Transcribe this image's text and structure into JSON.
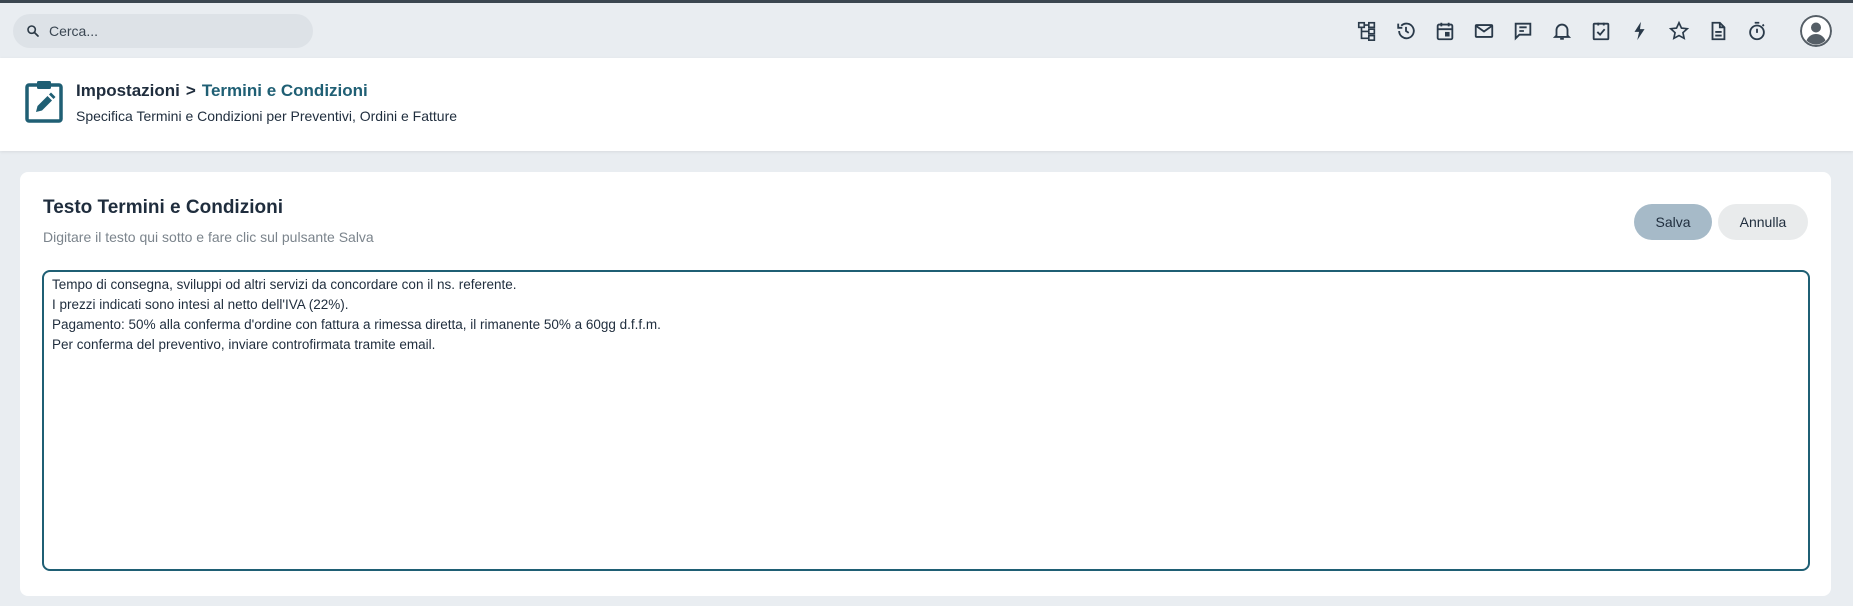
{
  "search": {
    "placeholder": "Cerca..."
  },
  "topbar_icons": [
    "sitemap-icon",
    "history-icon",
    "calendar-icon",
    "mail-icon",
    "chat-icon",
    "bell-icon",
    "task-check-icon",
    "lightning-icon",
    "star-icon",
    "document-icon",
    "timer-icon"
  ],
  "header": {
    "breadcrumb_parent": "Impostazioni",
    "breadcrumb_separator": ">",
    "breadcrumb_current": "Termini e Condizioni",
    "subtitle": "Specifica Termini e Condizioni per Preventivi, Ordini e Fatture"
  },
  "card": {
    "title": "Testo Termini e Condizioni",
    "subtitle": "Digitare il testo qui sotto e fare clic sul pulsante Salva",
    "save_label": "Salva",
    "cancel_label": "Annulla",
    "text_lines": [
      "Tempo di consegna, sviluppi od altri servizi da concordare con il ns. referente.",
      "I prezzi indicati sono intesi al netto dell'IVA (22%).",
      "Pagamento: 50% alla conferma d'ordine con fattura a rimessa diretta, il rimanente 50% a 60gg d.f.f.m.",
      "Per conferma del preventivo, inviare controfirmata tramite email."
    ]
  },
  "colors": {
    "accent": "#1f5f74",
    "save_button": "#a6bac8",
    "cancel_button": "#e9ebec",
    "background": "#e9edf1"
  }
}
